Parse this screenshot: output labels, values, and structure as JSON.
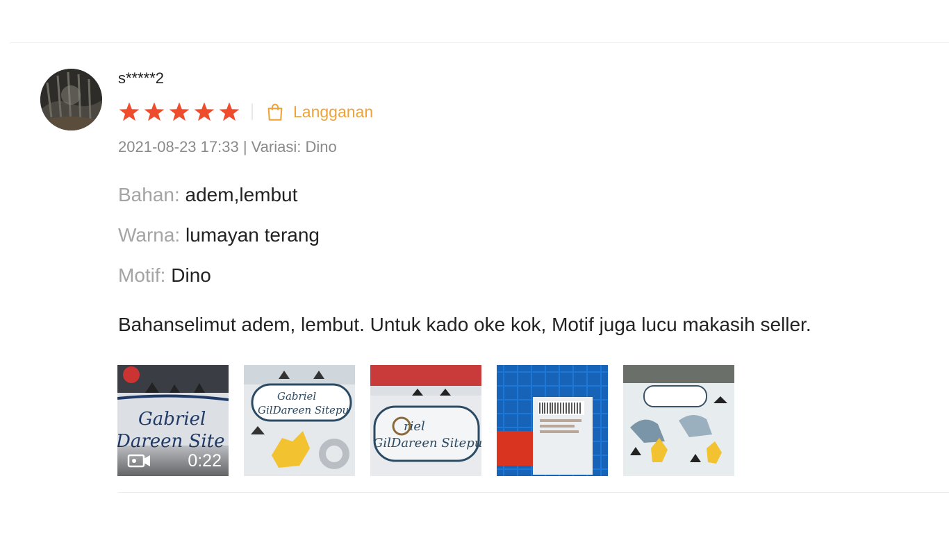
{
  "review": {
    "username": "s*****2",
    "rating": 5,
    "rating_max": 5,
    "badge_label": "Langganan",
    "meta": "2021-08-23 17:33 | Variasi: Dino",
    "attributes": [
      {
        "key": "Bahan:",
        "value": "adem,lembut"
      },
      {
        "key": "Warna:",
        "value": "lumayan terang"
      },
      {
        "key": "Motif:",
        "value": "Dino"
      }
    ],
    "comment": "Bahanselimut adem, lembut. Untuk kado oke kok, Motif juga lucu makasih seller.",
    "media": [
      {
        "type": "video",
        "duration": "0:22",
        "text": "Gabriel GilDareen Site"
      },
      {
        "type": "image",
        "text": "Gabriel GilDareen Sitepu"
      },
      {
        "type": "image",
        "text": "Gabriel GilDareen Sitepu"
      },
      {
        "type": "image",
        "text": "package"
      },
      {
        "type": "image",
        "text": "blanket"
      }
    ]
  },
  "colors": {
    "star": "#ee4d2d",
    "badge": "#eea33a",
    "label_grey": "#a4a4a4",
    "meta_grey": "#8a8a8a"
  },
  "icons": {
    "star": "star-icon",
    "badge": "shopping-bag-icon",
    "video": "video-camera-icon"
  }
}
